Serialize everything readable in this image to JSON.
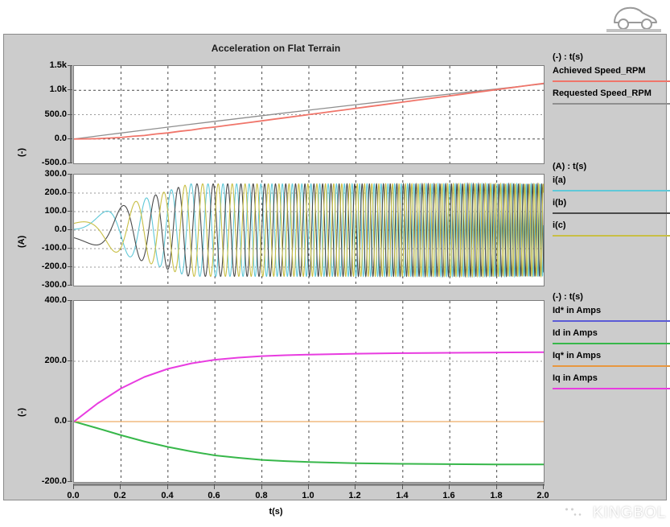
{
  "window": {
    "background_color": "#cccccc",
    "page_background": "#ffffff"
  },
  "header": {
    "car_icon": "car-icon"
  },
  "watermark": {
    "text": "KINGBOL",
    "icon": "wechat-icon"
  },
  "chart_data": [
    {
      "type": "line",
      "id": "speed-plot",
      "title": "Acceleration on Flat Terrain",
      "xlabel": "t(s)",
      "ylabel": "(-)",
      "xlim": [
        0.0,
        2.0
      ],
      "ylim": [
        -500.0,
        1500.0
      ],
      "xticks": [
        "0.0",
        "0.2",
        "0.4",
        "0.6",
        "0.8",
        "1.0",
        "1.2",
        "1.4",
        "1.6",
        "1.8",
        "2.0"
      ],
      "yticks": [
        "1.5k",
        "1.0k",
        "500.0",
        "0.0",
        "-500.0"
      ],
      "ytick_values": [
        1500,
        1000,
        500,
        0,
        -500
      ],
      "grid": true,
      "legend_position": "right",
      "legend_header": "(-) : t(s)",
      "series": [
        {
          "name": "Requested Speed_RPM",
          "color": "#8f8f8f",
          "x": [
            0.0,
            0.1,
            0.2,
            0.3,
            0.4,
            0.5,
            0.6,
            0.7,
            0.8,
            0.9,
            1.0,
            1.1,
            1.2,
            1.3,
            1.4,
            1.5,
            1.6,
            1.7,
            1.8,
            1.9,
            2.0
          ],
          "values": [
            0,
            62,
            123,
            184,
            244,
            303,
            362,
            420,
            478,
            535,
            592,
            648,
            704,
            759,
            814,
            868,
            922,
            975,
            1028,
            1081,
            1133
          ]
        },
        {
          "name": "Achieved Speed_RPM",
          "color": "#f0756a",
          "x": [
            0.0,
            0.1,
            0.2,
            0.3,
            0.4,
            0.5,
            0.6,
            0.7,
            0.8,
            0.9,
            1.0,
            1.1,
            1.2,
            1.3,
            1.4,
            1.5,
            1.6,
            1.7,
            1.8,
            1.9,
            2.0
          ],
          "values": [
            0,
            8,
            30,
            72,
            125,
            184,
            246,
            309,
            373,
            437,
            501,
            566,
            630,
            694,
            758,
            822,
            886,
            950,
            1012,
            1074,
            1135
          ]
        }
      ]
    },
    {
      "type": "line",
      "id": "phase-current-plot",
      "xlabel": "t(s)",
      "ylabel": "(A)",
      "xlim": [
        0.0,
        2.0
      ],
      "ylim": [
        -300.0,
        300.0
      ],
      "xticks": [
        "0.0",
        "0.2",
        "0.4",
        "0.6",
        "0.8",
        "1.0",
        "1.2",
        "1.4",
        "1.6",
        "1.8",
        "2.0"
      ],
      "yticks": [
        "300.0",
        "200.0",
        "100.0",
        "0.0",
        "-100.0",
        "-200.0",
        "-300.0"
      ],
      "ytick_values": [
        300,
        200,
        100,
        0,
        -100,
        -200,
        -300
      ],
      "grid": true,
      "legend_position": "right",
      "legend_header": "(A) : t(s)",
      "description": "Three-phase sinusoidal motor currents with amplitude ramping from 0 to ~250 A and frequency rising with speed; dense aliased waveform after t=0.6 s",
      "series": [
        {
          "name": "i(a)",
          "color": "#5fc8d8",
          "phase_deg": 240,
          "amplitude_final": 250
        },
        {
          "name": "i(b)",
          "color": "#4a4a4a",
          "phase_deg": 120,
          "amplitude_final": 250
        },
        {
          "name": "i(c)",
          "color": "#c8bf45",
          "phase_deg": 0,
          "amplitude_final": 250
        }
      ]
    },
    {
      "type": "line",
      "id": "dq-current-plot",
      "xlabel": "t(s)",
      "ylabel": "(-)",
      "xlim": [
        0.0,
        2.0
      ],
      "ylim": [
        -200.0,
        400.0
      ],
      "xticks": [
        "0.0",
        "0.2",
        "0.4",
        "0.6",
        "0.8",
        "1.0",
        "1.2",
        "1.4",
        "1.6",
        "1.8",
        "2.0"
      ],
      "yticks": [
        "400.0",
        "200.0",
        "0.0",
        "-200.0"
      ],
      "ytick_values": [
        400,
        200,
        0,
        -200
      ],
      "grid": true,
      "legend_position": "right",
      "legend_header": "(-) : t(s)",
      "series": [
        {
          "name": "Id* in Amps",
          "color": "#5b5bd6",
          "x": [
            0.0,
            0.2,
            0.4,
            0.6,
            0.8,
            1.0,
            1.2,
            1.4,
            1.6,
            1.8,
            2.0
          ],
          "values": [
            0,
            0,
            0,
            0,
            0,
            0,
            0,
            0,
            0,
            0,
            0
          ]
        },
        {
          "name": "Id in Amps",
          "color": "#37b74a",
          "x": [
            0.0,
            0.1,
            0.2,
            0.3,
            0.4,
            0.5,
            0.6,
            0.7,
            0.8,
            0.9,
            1.0,
            1.2,
            1.4,
            1.6,
            1.8,
            2.0
          ],
          "values": [
            0,
            -22,
            -45,
            -66,
            -84,
            -99,
            -112,
            -120,
            -127,
            -131,
            -134,
            -138,
            -140,
            -141,
            -142,
            -142
          ]
        },
        {
          "name": "Iq* in Amps",
          "color": "#e8973f",
          "x": [
            0.0,
            0.2,
            0.4,
            0.6,
            0.8,
            1.0,
            1.2,
            1.4,
            1.6,
            1.8,
            2.0
          ],
          "values": [
            0,
            0,
            0,
            0,
            0,
            0,
            0,
            0,
            0,
            0,
            0
          ]
        },
        {
          "name": "Iq in Amps",
          "color": "#e83ce0",
          "x": [
            0.0,
            0.1,
            0.2,
            0.3,
            0.4,
            0.5,
            0.6,
            0.7,
            0.8,
            0.9,
            1.0,
            1.2,
            1.4,
            1.6,
            1.8,
            2.0
          ],
          "values": [
            0,
            60,
            110,
            148,
            175,
            193,
            205,
            212,
            217,
            220,
            222,
            225,
            227,
            228,
            229,
            230
          ]
        }
      ]
    }
  ],
  "legends": [
    {
      "header": "(-) : t(s)",
      "entries": [
        {
          "label": "Achieved Speed_RPM",
          "color": "#f0756a"
        },
        {
          "label": "Requested Speed_RPM",
          "color": "#8f8f8f"
        }
      ]
    },
    {
      "header": "(A) : t(s)",
      "entries": [
        {
          "label": "i(a)",
          "color": "#5fc8d8"
        },
        {
          "label": "i(b)",
          "color": "#4a4a4a"
        },
        {
          "label": "i(c)",
          "color": "#c8bf45"
        }
      ]
    },
    {
      "header": "(-) : t(s)",
      "entries": [
        {
          "label": "Id* in Amps",
          "color": "#5b5bd6"
        },
        {
          "label": "Id in Amps",
          "color": "#37b74a"
        },
        {
          "label": "Iq* in Amps",
          "color": "#e8973f"
        },
        {
          "label": "Iq in Amps",
          "color": "#e83ce0"
        }
      ]
    }
  ]
}
